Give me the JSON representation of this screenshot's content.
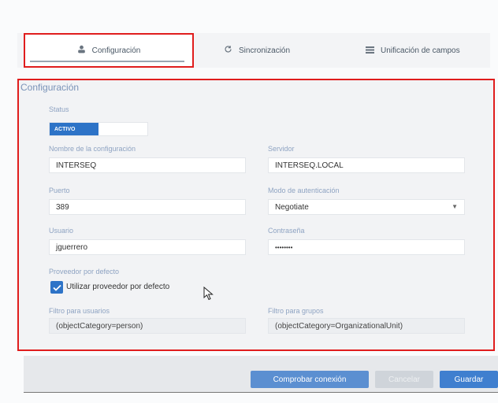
{
  "tabs": {
    "config": {
      "label": "Configuración",
      "icon": "user-icon"
    },
    "sync": {
      "label": "Sincronización",
      "icon": "refresh-icon"
    },
    "unif": {
      "label": "Unificación de campos",
      "icon": "list-icon"
    }
  },
  "section_title": "Configuración",
  "status": {
    "label": "Status",
    "toggle_on": "ACTIVO"
  },
  "fields": {
    "config_name": {
      "label": "Nombre de la configuración",
      "value": "INTERSEQ"
    },
    "server": {
      "label": "Servidor",
      "value": "INTERSEQ.LOCAL"
    },
    "port": {
      "label": "Puerto",
      "value": "389"
    },
    "auth_mode": {
      "label": "Modo de autenticación",
      "value": "Negotiate"
    },
    "user": {
      "label": "Usuario",
      "value": "jguerrero"
    },
    "password": {
      "label": "Contraseña",
      "value": "••••••••"
    },
    "default_provider": {
      "label": "Proveedor por defecto",
      "checkbox_label": "Utilizar proveedor por defecto",
      "checked": true
    },
    "user_filter": {
      "label": "Filtro para usuarios",
      "value": "(objectCategory=person)"
    },
    "group_filter": {
      "label": "Filtro para grupos",
      "value": "(objectCategory=OrganizationalUnit)"
    }
  },
  "buttons": {
    "check": "Comprobar conexión",
    "cancel": "Cancelar",
    "save": "Guardar"
  },
  "colors": {
    "accent": "#2d73c7",
    "highlight": "#e01d1d"
  }
}
